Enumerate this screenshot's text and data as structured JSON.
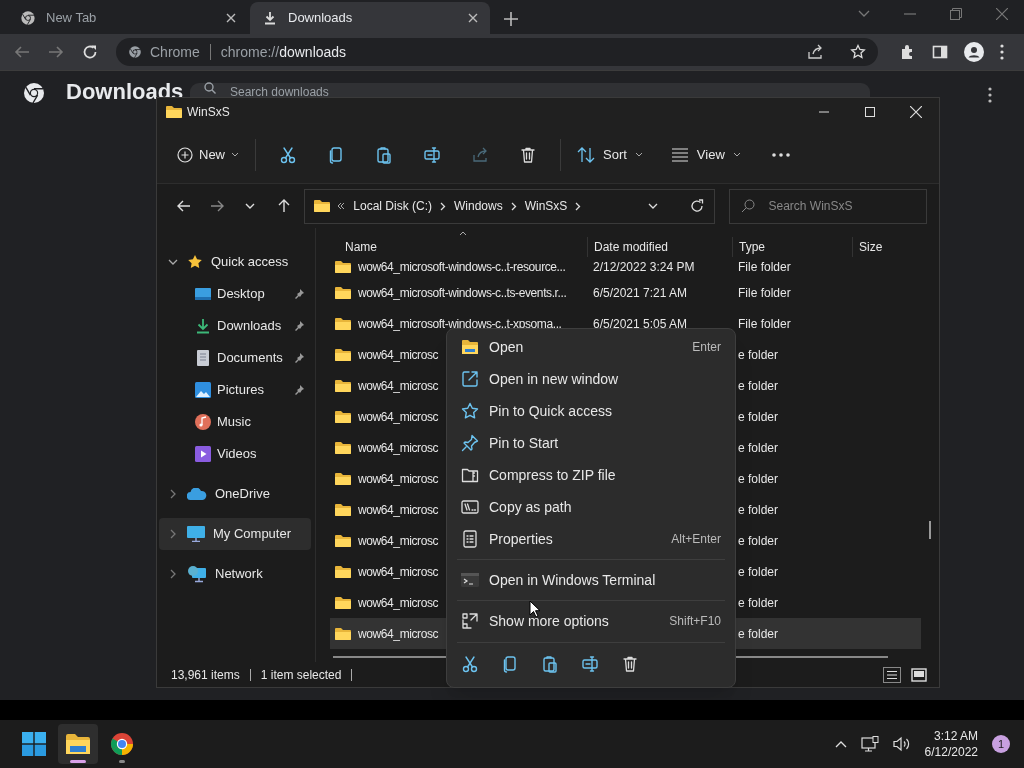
{
  "browser": {
    "tabs": [
      {
        "title": "New Tab",
        "selected": false
      },
      {
        "title": "Downloads",
        "selected": true
      }
    ],
    "omnibox": {
      "site_label": "Chrome",
      "url_scheme": "chrome://",
      "url_path": "downloads"
    }
  },
  "page": {
    "title": "Downloads",
    "search": {
      "placeholder": "Search downloads"
    }
  },
  "explorer": {
    "title": "WinSxS",
    "toolbar": {
      "new": "New",
      "sort": "Sort",
      "view": "View"
    },
    "address": {
      "crumbs": [
        "Local Disk (C:)",
        "Windows",
        "WinSxS"
      ]
    },
    "search": {
      "placeholder": "Search WinSxS"
    },
    "columns": [
      "Name",
      "Date modified",
      "Type",
      "Size"
    ],
    "nav": [
      {
        "label": "Quick access",
        "expanded": true,
        "selected": false,
        "children": [
          {
            "label": "Desktop",
            "pinned": true,
            "selected": false
          },
          {
            "label": "Downloads",
            "pinned": true,
            "selected": false
          },
          {
            "label": "Documents",
            "pinned": true,
            "selected": false
          },
          {
            "label": "Pictures",
            "pinned": true,
            "selected": false
          },
          {
            "label": "Music",
            "pinned": false,
            "selected": false
          },
          {
            "label": "Videos",
            "pinned": false,
            "selected": false
          }
        ]
      },
      {
        "label": "OneDrive",
        "expanded": false,
        "selected": false
      },
      {
        "label": "My Computer",
        "expanded": false,
        "selected": true
      },
      {
        "label": "Network",
        "expanded": false,
        "selected": false
      }
    ],
    "rows": [
      {
        "name": "wow64_microsoft-windows-c..t-resource...",
        "date": "2/12/2022 3:24 PM",
        "type": "File folder",
        "selected": false
      },
      {
        "name": "wow64_microsoft-windows-c..ts-events.r...",
        "date": "6/5/2021 7:21 AM",
        "type": "File folder",
        "selected": false
      },
      {
        "name": "wow64_microsoft-windows-c..t-xpsoma...",
        "date": "6/5/2021 5:05 AM",
        "type": "File folder",
        "selected": false
      },
      {
        "name": "wow64_microsc",
        "type": "e folder",
        "selected": false
      },
      {
        "name": "wow64_microsc",
        "type": "e folder",
        "selected": false
      },
      {
        "name": "wow64_microsc",
        "type": "e folder",
        "selected": false
      },
      {
        "name": "wow64_microsc",
        "type": "e folder",
        "selected": false
      },
      {
        "name": "wow64_microsc",
        "type": "e folder",
        "selected": false
      },
      {
        "name": "wow64_microsc",
        "type": "e folder",
        "selected": false
      },
      {
        "name": "wow64_microsc",
        "type": "e folder",
        "selected": false
      },
      {
        "name": "wow64_microsc",
        "type": "e folder",
        "selected": false
      },
      {
        "name": "wow64_microsc",
        "type": "e folder",
        "selected": false
      },
      {
        "name": "wow64_microsc",
        "type": "e folder",
        "selected": true
      }
    ],
    "status": {
      "count": "13,961 items",
      "selection": "1 item selected"
    }
  },
  "context_menu": {
    "groups": [
      [
        {
          "label": "Open",
          "shortcut": "Enter"
        },
        {
          "label": "Open in new window"
        },
        {
          "label": "Pin to Quick access"
        },
        {
          "label": "Pin to Start"
        },
        {
          "label": "Compress to ZIP file"
        },
        {
          "label": "Copy as path"
        },
        {
          "label": "Properties",
          "shortcut": "Alt+Enter"
        }
      ],
      [
        {
          "label": "Open in Windows Terminal"
        }
      ],
      [
        {
          "label": "Show more options",
          "shortcut": "Shift+F10"
        }
      ]
    ]
  },
  "taskbar": {
    "apps": [
      {
        "running": false,
        "selected": false
      },
      {
        "running": true,
        "selected": true
      },
      {
        "running": true,
        "selected": false
      }
    ],
    "time": "3:12 AM",
    "date": "6/12/2022",
    "badge": "1"
  }
}
